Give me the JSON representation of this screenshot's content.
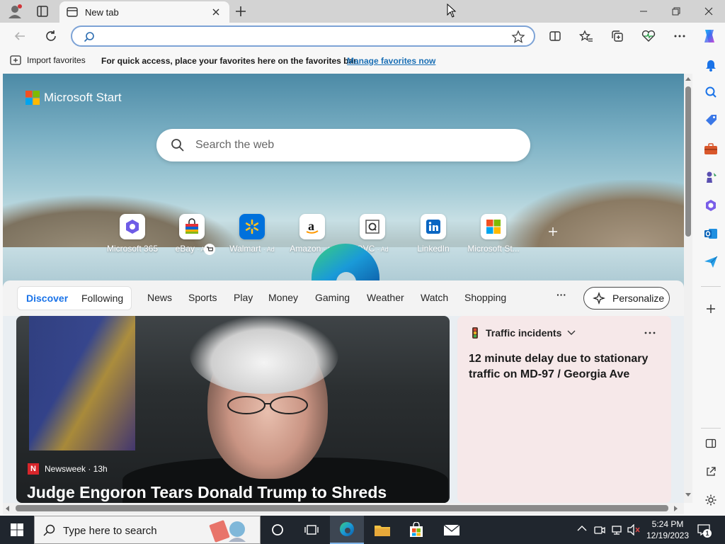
{
  "browser": {
    "tab_title": "New tab",
    "address_value": "",
    "favorites_bar": {
      "import_label": "Import favorites",
      "message": "For quick access, place your favorites here on the favorites bar.",
      "link": "Manage favorites now"
    }
  },
  "newtab": {
    "brand": "Microsoft Start",
    "search_placeholder": "Search the web",
    "sites": [
      {
        "label": "Microsoft 365",
        "ad": ""
      },
      {
        "label": "eBay",
        "ad": "· Ad"
      },
      {
        "label": "Walmart",
        "ad": "· Ad"
      },
      {
        "label": "Amazon",
        "ad": "· Ad"
      },
      {
        "label": "QVC",
        "ad": "· Ad"
      },
      {
        "label": "LinkedIn",
        "ad": ""
      },
      {
        "label": "Microsoft St...",
        "ad": ""
      }
    ],
    "feed_tabs": [
      "Discover",
      "Following",
      "News",
      "Sports",
      "Play",
      "Money",
      "Gaming",
      "Weather",
      "Watch",
      "Shopping"
    ],
    "more_label": "···",
    "personalize_label": "Personalize",
    "card": {
      "source": "Newsweek · 13h",
      "source_logo": "N",
      "headline": "Judge Engoron Tears Donald Trump to Shreds"
    },
    "traffic": {
      "title": "Traffic incidents",
      "body": "12 minute delay due to stationary traffic on MD-97 / Georgia Ave"
    }
  },
  "taskbar": {
    "search_placeholder": "Type here to search",
    "time": "5:24 PM",
    "date": "12/19/2023",
    "notification_count": "1"
  }
}
